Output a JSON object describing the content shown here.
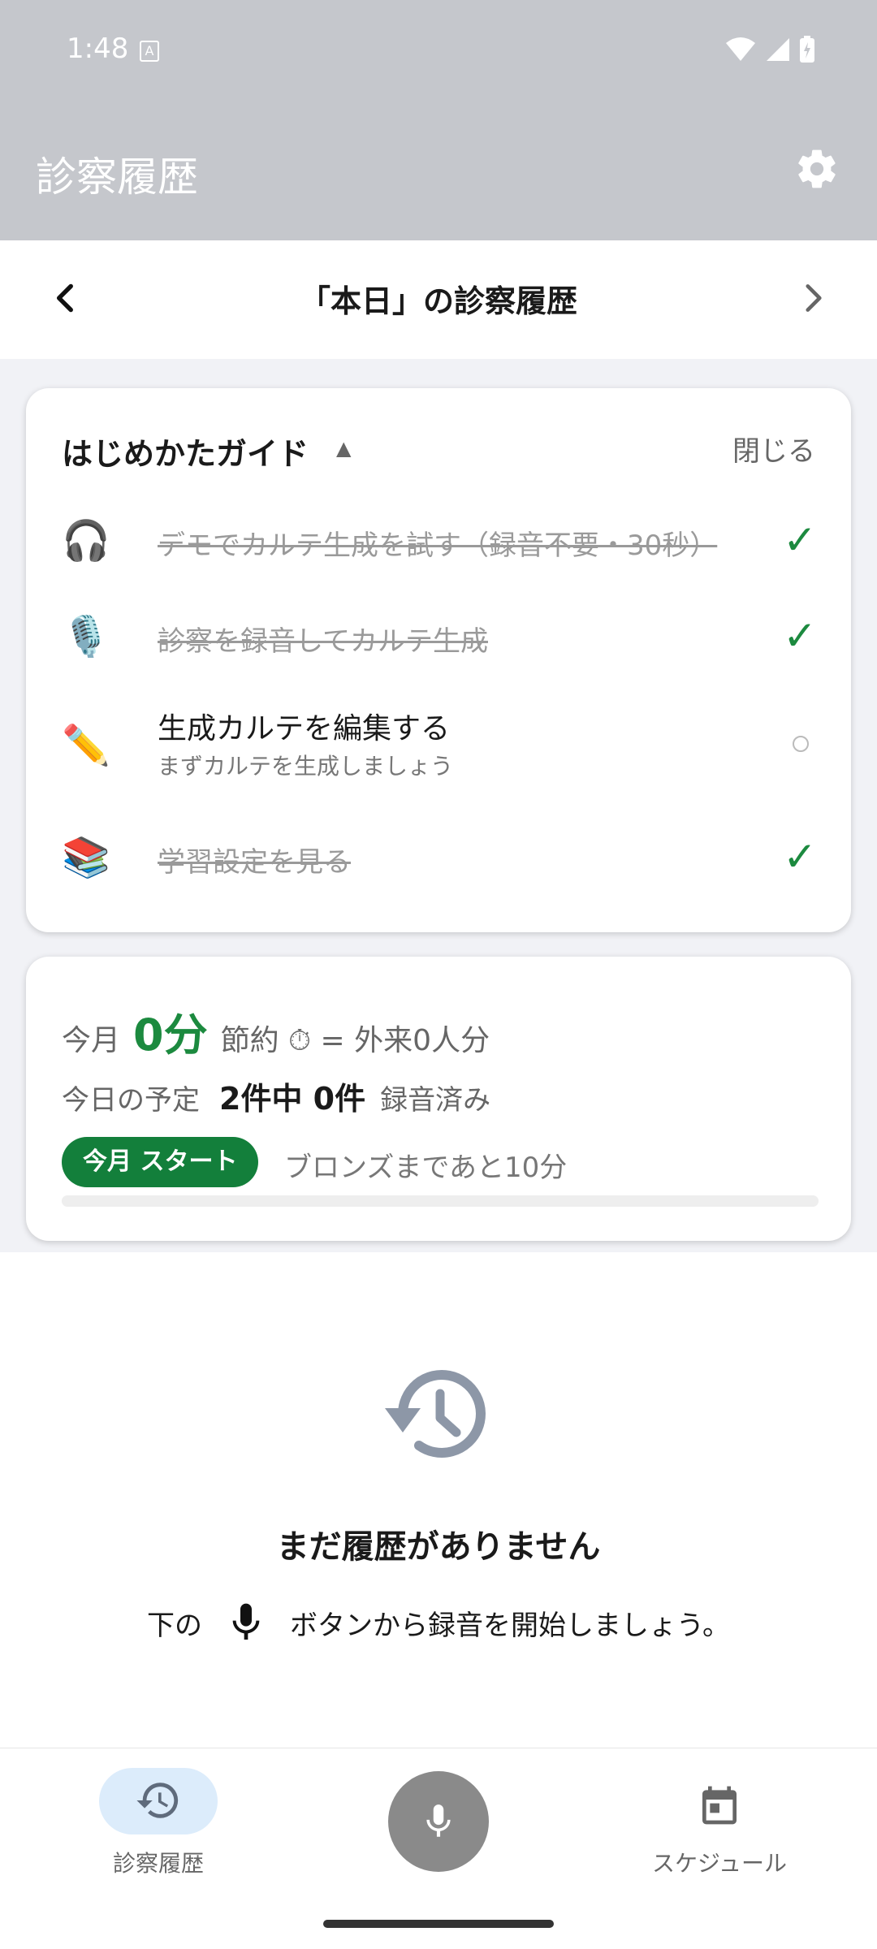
{
  "status": {
    "time": "1:48"
  },
  "app": {
    "title": "診察履歴"
  },
  "datebar": {
    "title": "「本日」の診察履歴"
  },
  "guide": {
    "title": "はじめかたガイド",
    "toggle_symbol": "▲",
    "close_label": "閉じる",
    "items": [
      {
        "icon": "headphones-icon",
        "emoji": "🎧",
        "label": "デモでカルテ生成を試す（録音不要・30秒）",
        "done": true,
        "check": "✓"
      },
      {
        "icon": "microphone-icon",
        "emoji": "🎙️",
        "label": "診察を録音してカルテ生成",
        "done": true,
        "check": "✓"
      },
      {
        "icon": "pencil-icon",
        "emoji": "✏️",
        "label": "生成カルテを編集する",
        "sub": "まずカルテを生成しましょう",
        "done": false
      },
      {
        "icon": "books-icon",
        "emoji": "📚",
        "label": "学習設定を見る",
        "done": true,
        "check": "✓"
      }
    ]
  },
  "stats": {
    "month_prefix": "今月",
    "saved_value": "0分",
    "saved_suffix": "節約 ⏱ = 外来0人分",
    "today_prefix": "今日の予定",
    "today_value": "2件中 0件",
    "today_suffix": "録音済み",
    "badge": "今月 スタート",
    "next_rank": "ブロンズまであと10分",
    "progress": 0
  },
  "empty": {
    "title": "まだ履歴がありません",
    "desc_before": "下の",
    "desc_after": "ボタンから録音を開始しましょう。"
  },
  "nav": {
    "history_label": "診察履歴",
    "schedule_label": "スケジュール"
  },
  "colors": {
    "accent": "#1c8a3f",
    "appbar": "#c5c7cc",
    "pill": "#dcecfb"
  }
}
